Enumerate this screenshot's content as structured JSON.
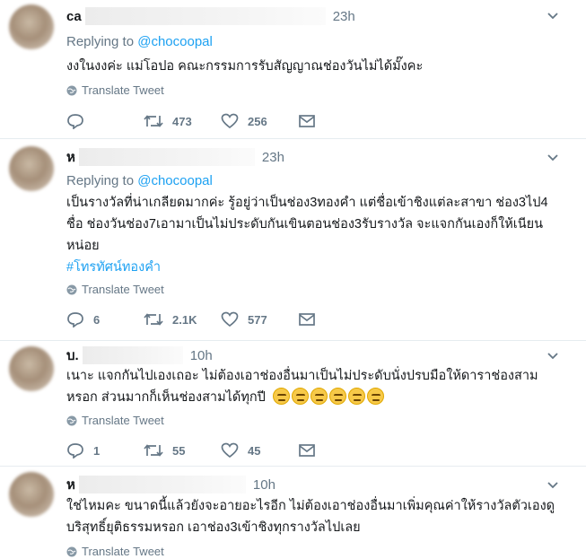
{
  "tweets": [
    {
      "name": "ca",
      "time": "23h",
      "reply_prefix": "Replying to",
      "reply_handle": "@chocoopal",
      "text": "งงในงงค่ะ แม่โอปอ คณะกรรมการรับสัญญาณช่องวันไม่ได้มั๊งคะ",
      "translate": "Translate Tweet",
      "replies": "",
      "retweets": "473",
      "likes": "256"
    },
    {
      "name": "ห",
      "time": "23h",
      "reply_prefix": "Replying to",
      "reply_handle": "@chocoopal",
      "text_lines": [
        "เป็นรางวัลที่น่าเกลียดมากค่ะ รู้อยู่ว่าเป็นช่อง3ทองคำ แต่ชื่อเข้าชิงแต่ละสาขา ช่อง3ไป4",
        "ชื่อ ช่องวันช่อง7เอามาเป็นไม่ประดับกันเขินตอนช่อง3รับรางวัล จะแจกกันเองก็ให้เนียน",
        "หน่อย"
      ],
      "hashtag": "#โทรทัศน์ทองคำ",
      "translate": "Translate Tweet",
      "replies": "6",
      "retweets": "2.1K",
      "likes": "577"
    },
    {
      "name": "บ.",
      "time": "10h",
      "text_lines": [
        "เนาะ แจกกันไปเองเถอะ ไม่ต้องเอาช่องอื่นมาเป็นไม่ประดับนั่งปรบมือให้ดาราช่องสาม",
        "หรอก ส่วนมากก็เห็นช่องสามได้ทุกปี"
      ],
      "emojis": [
        "smirking-face-icon",
        "smirking-face-icon",
        "smirking-face-icon",
        "unamused-face-icon",
        "unamused-face-icon",
        "unamused-face-icon"
      ],
      "translate": "Translate Tweet",
      "replies": "1",
      "retweets": "55",
      "likes": "45"
    },
    {
      "name": "ห",
      "time": "10h",
      "text_lines": [
        "ใช่ไหมคะ ขนาดนี้แล้วยังจะอายอะไรอีก ไม่ต้องเอาช่องอื่นมาเพิ่มคุณค่าให้รางวัลตัวเองดู",
        "บริสุทธิ์ยุติธรรมหรอก เอาช่อง3เข้าชิงทุกรางวัลไปเลย"
      ],
      "translate": "Translate Tweet"
    }
  ],
  "icons": {
    "reply": "reply-icon",
    "retweet": "retweet-icon",
    "like": "heart-icon",
    "dm": "envelope-icon",
    "menu": "chevron-down-icon",
    "translate": "globe-icon"
  },
  "colors": {
    "link": "#1da1f2",
    "muted": "#657786",
    "divider": "#e6ecf0"
  }
}
